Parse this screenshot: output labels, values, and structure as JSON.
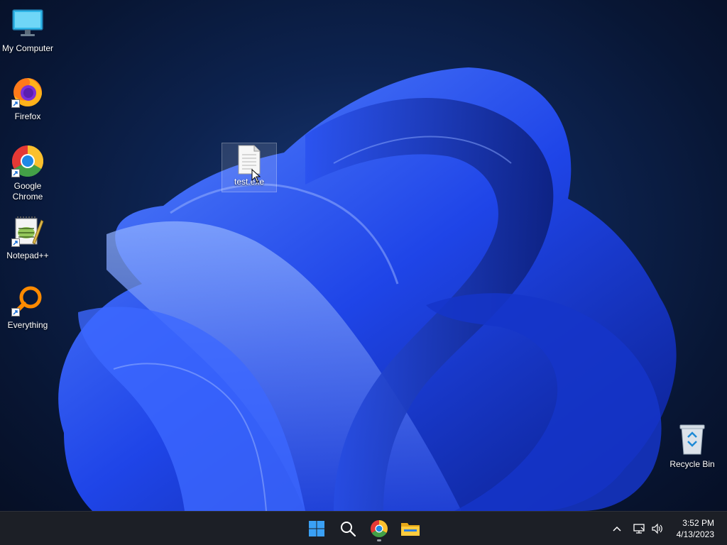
{
  "desktop_icons": [
    {
      "label": "My Computer",
      "icon": "monitor-icon"
    },
    {
      "label": "Firefox",
      "icon": "firefox-icon"
    },
    {
      "label": "Google\nChrome",
      "icon": "chrome-icon"
    },
    {
      "label": "Notepad++",
      "icon": "notepadpp-icon"
    },
    {
      "label": "Everything",
      "icon": "everything-search-icon"
    },
    {
      "label": "test.exe",
      "icon": "file-icon"
    },
    {
      "label": "Recycle Bin",
      "icon": "recycle-bin-icon"
    }
  ],
  "taskbar": {
    "pinned": [
      {
        "icon": "windows-start-icon"
      },
      {
        "icon": "search-icon"
      },
      {
        "icon": "chrome-icon"
      },
      {
        "icon": "file-explorer-icon"
      }
    ],
    "tray": [
      {
        "icon": "chevron-up-icon"
      },
      {
        "icon": "network-icon"
      },
      {
        "icon": "volume-icon"
      }
    ],
    "clock": {
      "time": "3:52 PM",
      "date": "4/13/2023"
    }
  },
  "colors": {
    "taskbar": "#1c1f26",
    "wallpaper_blue": "#2f5cff",
    "wallpaper_dark": "#081634",
    "windows_accent": "#3aa0f5"
  }
}
